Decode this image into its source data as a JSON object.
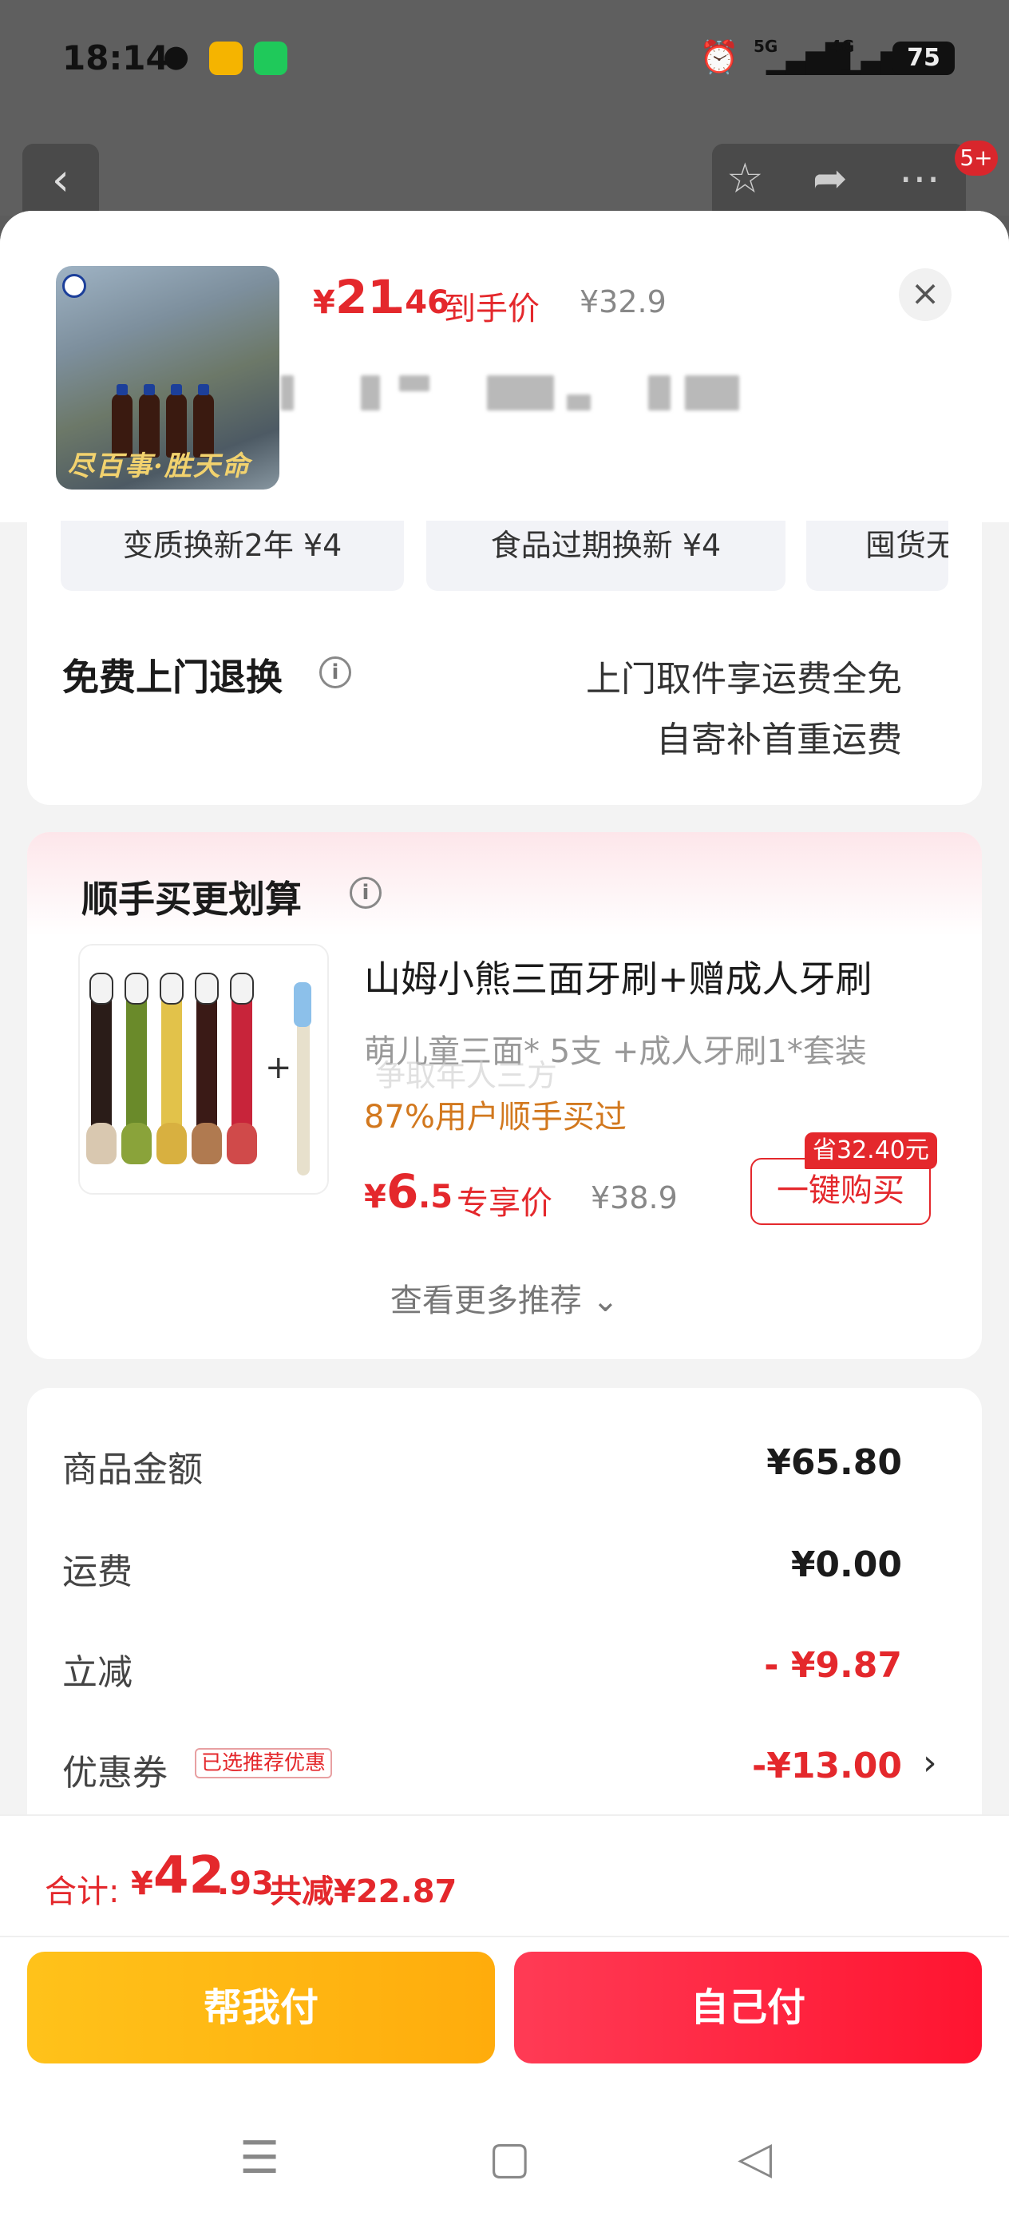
{
  "status_bar": {
    "time": "18:14",
    "network1": "5G",
    "network2": "4G",
    "battery": "75"
  },
  "top_nav": {
    "notification_count": "5+"
  },
  "product": {
    "slogan": "尽百事·胜天命",
    "price_symbol": "¥",
    "price_int": "21",
    "price_dec": ".46",
    "price_label": "到手价",
    "original_price": "¥32.9"
  },
  "services": {
    "chips": [
      "变质换新2年 ¥4",
      "食品过期换新 ¥4",
      "囤货无"
    ],
    "title": "免费上门退换",
    "line1": "上门取件享运费全免",
    "line2": "自寄补首重运费"
  },
  "recommend": {
    "title": "顺手买更划算",
    "product_name": "山姆小熊三面牙刷+赠成人牙刷",
    "desc": "萌儿童三面* 5支 +成人牙刷1*套装",
    "ghost_text": "争取年人三方",
    "buyers": "87%用户顺手买过",
    "price_symbol": "¥",
    "price_int": "6",
    "price_dec": ".5",
    "price_label": "专享价",
    "original_price": "¥38.9",
    "save_badge": "省32.40元",
    "buy_button": "一键购买",
    "more": "查看更多推荐 ⌄"
  },
  "summary": {
    "rows": [
      {
        "label": "商品金额",
        "value": "¥65.80"
      },
      {
        "label": "运费",
        "value": "¥0.00"
      },
      {
        "label": "立减",
        "value": "- ¥9.87"
      },
      {
        "label": "优惠券",
        "value": "-¥13.00"
      }
    ],
    "coupon_tag": "已选推荐优惠"
  },
  "footer": {
    "total_label": "合计:",
    "total_symbol": "¥",
    "total_int": "42",
    "total_dec": ".93",
    "total_saved": "共减¥22.87",
    "help_pay": "帮我付",
    "self_pay": "自己付"
  },
  "colors": {
    "accent_red": "#e4282c",
    "help_yellow": "#ffb412",
    "pay_red": "#ff2340"
  }
}
